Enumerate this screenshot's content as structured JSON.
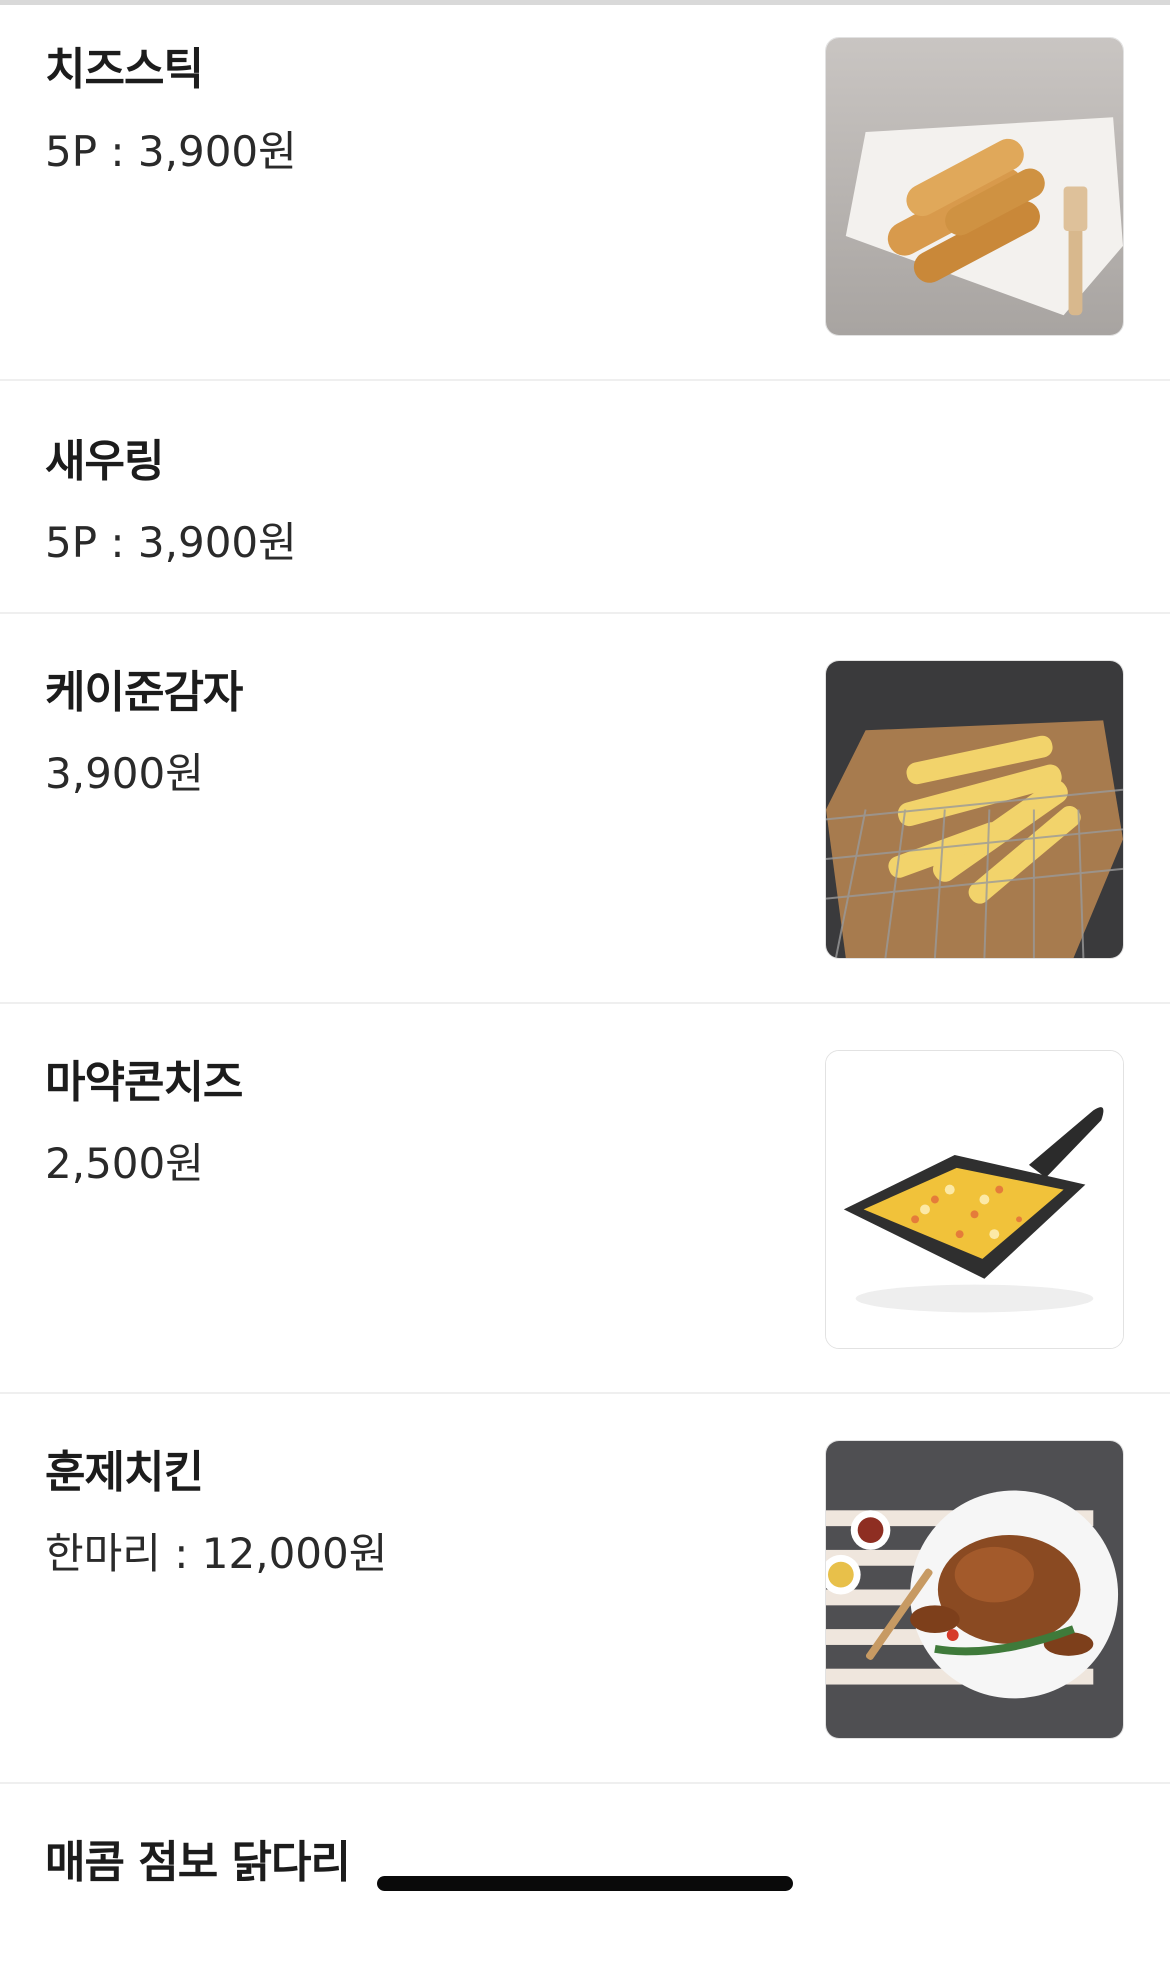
{
  "menu": {
    "items": [
      {
        "name": "치즈스틱",
        "price": "5P : 3,900원",
        "image_icon": "cheese-stick-photo"
      },
      {
        "name": "새우링",
        "price": "5P : 3,900원"
      },
      {
        "name": "케이준감자",
        "price": "3,900원",
        "image_icon": "cajun-fries-photo"
      },
      {
        "name": "마약콘치즈",
        "price": "2,500원",
        "image_icon": "corn-cheese-photo"
      },
      {
        "name": "훈제치킨",
        "price": "한마리 : 12,000원",
        "image_icon": "smoked-chicken-photo"
      },
      {
        "name": "매콤 점보 닭다리"
      }
    ]
  }
}
